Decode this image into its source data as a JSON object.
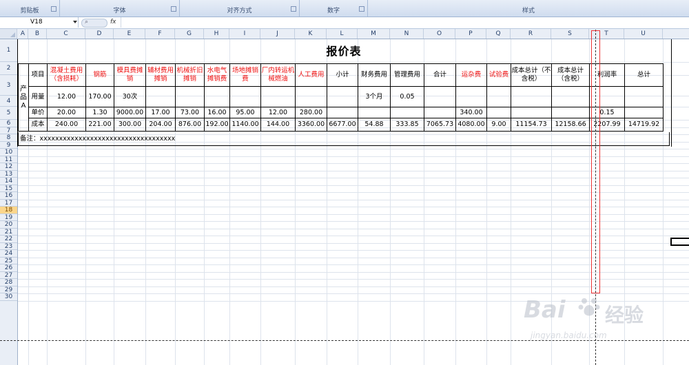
{
  "ribbon": {
    "groups": [
      "剪贴板",
      "字体",
      "对齐方式",
      "数字",
      "样式"
    ]
  },
  "formula_bar": {
    "name_box": "V18",
    "fx_label": "fx",
    "formula": ""
  },
  "columns": [
    "A",
    "B",
    "C",
    "D",
    "E",
    "F",
    "G",
    "H",
    "I",
    "J",
    "K",
    "L",
    "M",
    "N",
    "O",
    "P",
    "Q",
    "R",
    "S",
    "T",
    "U"
  ],
  "rows": [
    "1",
    "2",
    "3",
    "4",
    "5",
    "6",
    "7",
    "8",
    "9",
    "10",
    "11",
    "12",
    "13",
    "14",
    "15",
    "16",
    "17",
    "18",
    "19",
    "20",
    "21",
    "22",
    "23",
    "24",
    "25",
    "26",
    "27",
    "28",
    "29",
    "30"
  ],
  "selected_row": "18",
  "sheet": {
    "title": "报价表",
    "product_label": "产品A",
    "header": [
      "项目",
      "混凝土费用（含损耗）",
      "钢筋",
      "模具费摊销",
      "辅材费用摊销",
      "机械折旧摊销",
      "水电气摊销费",
      "场地摊销费",
      "厂内转运机械燃油",
      "人工费用",
      "小计",
      "财务费用",
      "管理费用",
      "合计",
      "运杂费",
      "试验费",
      "成本总计（不含税）",
      "成本总计（含税）",
      "利润率",
      "总计"
    ],
    "red_headers": [
      1,
      2,
      3,
      4,
      5,
      6,
      7,
      8,
      9,
      14,
      15
    ],
    "rows": [
      [
        "用量",
        "12.00",
        "170.00",
        "30次",
        "",
        "",
        "",
        "",
        "",
        "",
        "",
        "3个月",
        "0.05",
        "",
        "",
        "",
        "",
        "",
        "",
        ""
      ],
      [
        "单价",
        "20.00",
        "1.30",
        "9000.00",
        "17.00",
        "73.00",
        "16.00",
        "95.00",
        "12.00",
        "280.00",
        "",
        "",
        "",
        "",
        "340.00",
        "",
        "",
        "",
        "0.15",
        ""
      ],
      [
        "成本",
        "240.00",
        "221.00",
        "300.00",
        "204.00",
        "876.00",
        "192.00",
        "1140.00",
        "144.00",
        "3360.00",
        "6677.00",
        "54.88",
        "333.85",
        "7065.73",
        "4080.00",
        "9.00",
        "11154.73",
        "12158.66",
        "2207.99",
        "14719.92"
      ]
    ],
    "note": "备注：xxxxxxxxxxxxxxxxxxxxxxxxxxxxxxxxxxx"
  },
  "watermark": {
    "brand": "Bai",
    "brand_cn": "经验",
    "url": "jingyan.baidu.com"
  }
}
